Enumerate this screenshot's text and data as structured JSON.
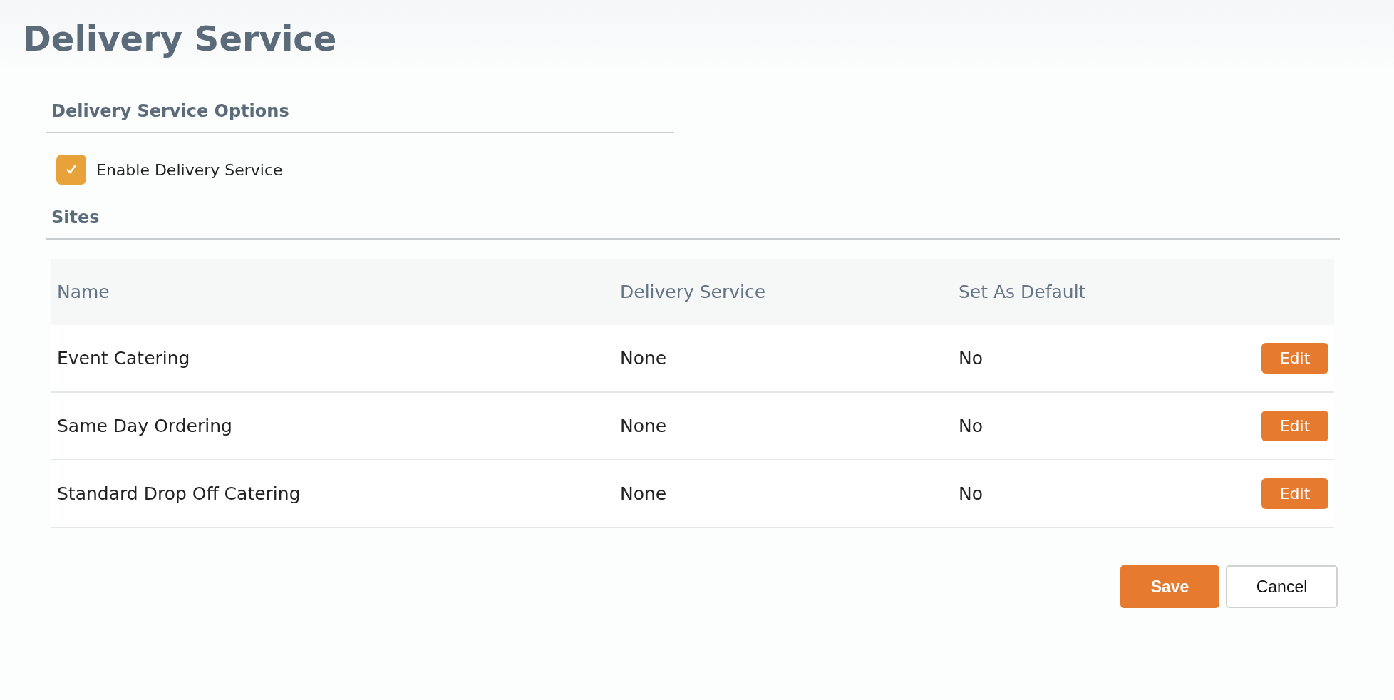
{
  "page": {
    "title": "Delivery Service"
  },
  "options": {
    "heading": "Delivery Service Options",
    "checkbox": {
      "label": "Enable Delivery Service",
      "checked": true
    }
  },
  "sites": {
    "heading": "Sites",
    "columns": [
      "Name",
      "Delivery Service",
      "Set As Default"
    ],
    "rows": [
      {
        "name": "Event Catering",
        "delivery_service": "None",
        "default": "No",
        "action": "Edit"
      },
      {
        "name": "Same Day Ordering",
        "delivery_service": "None",
        "default": "No",
        "action": "Edit"
      },
      {
        "name": "Standard Drop Off Catering",
        "delivery_service": "None",
        "default": "No",
        "action": "Edit"
      }
    ]
  },
  "buttons": [
    {
      "label": "Save",
      "kind": "primary"
    },
    {
      "label": "Cancel",
      "kind": "secondary"
    }
  ]
}
